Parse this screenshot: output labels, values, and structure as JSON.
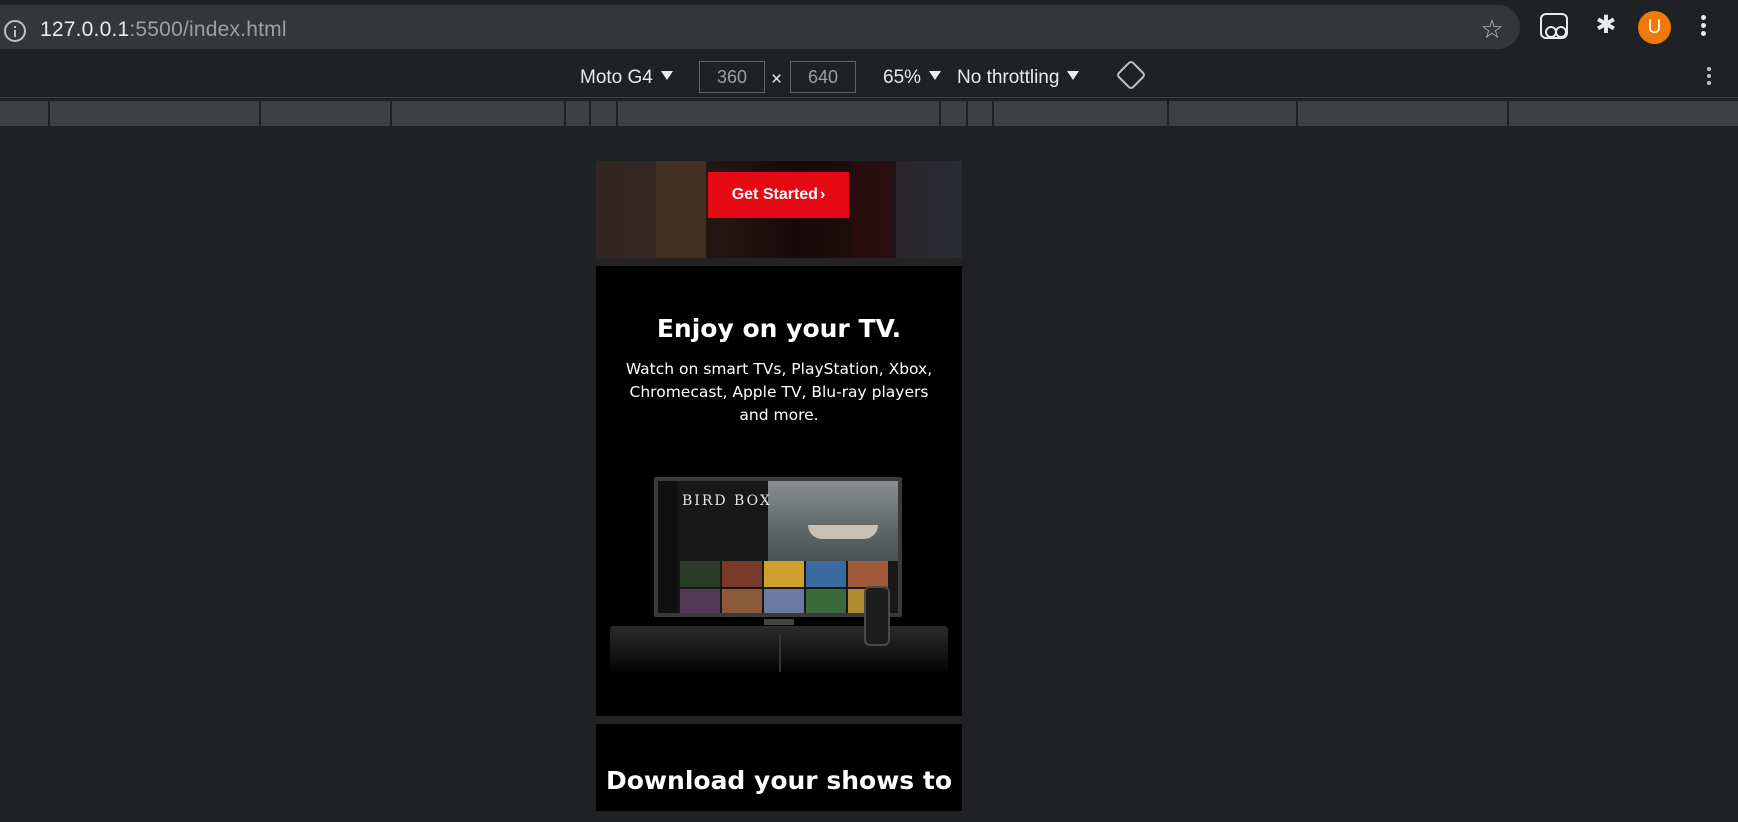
{
  "browser": {
    "url_host": "127.0.0.1",
    "url_path": ":5500/index.html",
    "avatar_initial": "U"
  },
  "devtools": {
    "device": "Moto G4",
    "width": "360",
    "times": "×",
    "height": "640",
    "zoom": "65%",
    "throttling": "No throttling"
  },
  "page": {
    "hero_button": "Get Started",
    "hero_button_chevron": "›",
    "tv_section": {
      "title": "Enjoy on your TV.",
      "text": "Watch on smart TVs, PlayStation, Xbox, Chromecast, Apple TV, Blu-ray players and more.",
      "screen_title": "BIRD BOX"
    },
    "download_section": {
      "title": "Download your shows to"
    }
  },
  "colors": {
    "accent_red": "#e50914",
    "avatar_orange": "#f07a08",
    "card_bg": "#000000",
    "chrome_bg": "#202124"
  }
}
